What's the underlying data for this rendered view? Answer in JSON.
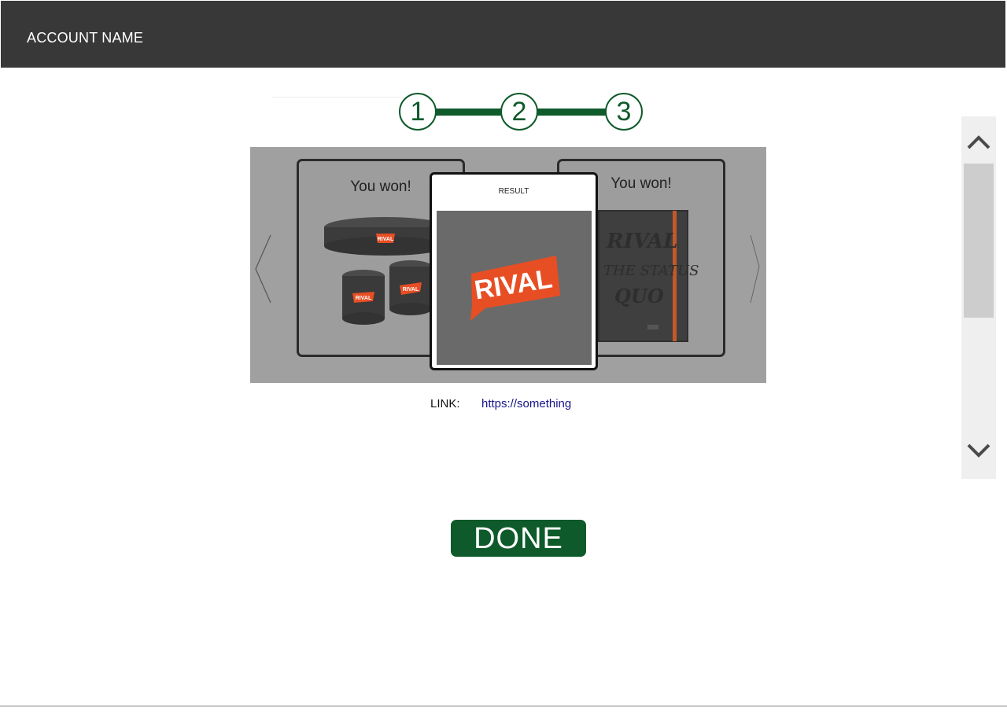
{
  "header": {
    "title": "ACCOUNT NAME"
  },
  "stepper": {
    "steps": [
      "1",
      "2",
      "3"
    ],
    "accent": "#0e5a2a"
  },
  "carousel": {
    "left_card": {
      "title": "You won!",
      "brand": "RIVAL"
    },
    "center_card": {
      "label": "RESULT",
      "brand": "RIVAL"
    },
    "right_card": {
      "title": "You won!",
      "notebook_text": [
        "RIVAL",
        "THE STATUS",
        "QUO"
      ]
    },
    "prev_icon": "chevron-left-icon",
    "next_icon": "chevron-right-icon"
  },
  "link": {
    "label": "LINK:",
    "url": "https://something"
  },
  "scrollbar": {
    "up_icon": "chevron-up-icon",
    "down_icon": "chevron-down-icon"
  },
  "actions": {
    "done_label": "DONE"
  },
  "colors": {
    "header_bg": "#383838",
    "brand_orange": "#e84e24",
    "link": "#17168a"
  }
}
